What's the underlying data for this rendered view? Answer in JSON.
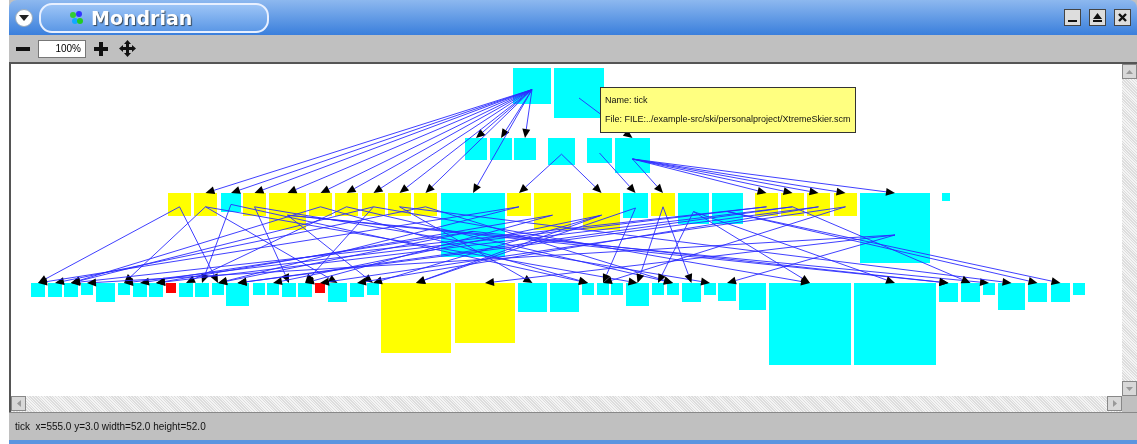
{
  "window": {
    "title": "Mondrian"
  },
  "toolbar": {
    "zoom": {
      "value": "100%"
    }
  },
  "graph": {
    "nodes": [
      {
        "color": "#00ffff"
      },
      {
        "color": "#00ffff"
      },
      {
        "color": "#00ffff"
      },
      {
        "color": "#00ffff"
      },
      {
        "color": "#00ffff"
      },
      {
        "color": "#00ffff"
      },
      {
        "color": "#00ffff"
      },
      {
        "color": "#00ffff"
      },
      {
        "color": "#ffff00"
      },
      {
        "color": "#ffff00"
      },
      {
        "color": "#00ffff"
      },
      {
        "color": "#ffff00"
      },
      {
        "color": "#ffff00"
      },
      {
        "color": "#ffff00"
      },
      {
        "color": "#ffff00"
      },
      {
        "color": "#ffff00"
      },
      {
        "color": "#ffff00"
      },
      {
        "color": "#ffff00"
      },
      {
        "color": "#00ffff"
      },
      {
        "color": "#ffff00"
      },
      {
        "color": "#ffff00"
      },
      {
        "color": "#ffff00"
      },
      {
        "color": "#00ffff"
      },
      {
        "color": "#ffff00"
      },
      {
        "color": "#00ffff"
      },
      {
        "color": "#00ffff"
      },
      {
        "color": "#ffff00"
      },
      {
        "color": "#ffff00"
      },
      {
        "color": "#ffff00"
      },
      {
        "color": "#ffff00"
      },
      {
        "color": "#00ffff"
      },
      {
        "color": "#00ffff"
      },
      {
        "color": "#00ffff"
      },
      {
        "color": "#00ffff"
      },
      {
        "color": "#00ffff"
      },
      {
        "color": "#00ffff"
      },
      {
        "color": "#00ffff"
      },
      {
        "color": "#00ffff"
      },
      {
        "color": "#00ffff"
      },
      {
        "color": "#00ffff"
      },
      {
        "color": "#ff0000"
      },
      {
        "color": "#00ffff"
      },
      {
        "color": "#00ffff"
      },
      {
        "color": "#00ffff"
      },
      {
        "color": "#00ffff"
      },
      {
        "color": "#00ffff"
      },
      {
        "color": "#00ffff"
      },
      {
        "color": "#00ffff"
      },
      {
        "color": "#00ffff"
      },
      {
        "color": "#ff0000"
      },
      {
        "color": "#00ffff"
      },
      {
        "color": "#00ffff"
      },
      {
        "color": "#00ffff"
      },
      {
        "color": "#ffff00"
      },
      {
        "color": "#ffff00"
      },
      {
        "color": "#00ffff"
      },
      {
        "color": "#00ffff"
      },
      {
        "color": "#00ffff"
      },
      {
        "color": "#00ffff"
      },
      {
        "color": "#00ffff"
      },
      {
        "color": "#00ffff"
      },
      {
        "color": "#00ffff"
      },
      {
        "color": "#00ffff"
      },
      {
        "color": "#00ffff"
      },
      {
        "color": "#00ffff"
      },
      {
        "color": "#00ffff"
      },
      {
        "color": "#00ffff"
      },
      {
        "color": "#00ffff"
      },
      {
        "color": "#00ffff"
      },
      {
        "color": "#00ffff"
      },
      {
        "color": "#00ffff"
      },
      {
        "color": "#00ffff"
      },
      {
        "color": "#00ffff"
      },
      {
        "color": "#00ffff"
      },
      {
        "color": "#00ffff"
      },
      {
        "color": "#00ffff"
      }
    ]
  },
  "tooltip": {
    "name": "Name: tick",
    "file": "File: FILE:../example-src/ski/personalproject/XtremeSkier.scm"
  },
  "status_bar": {
    "text": "tick  x=555.0 y=3.0 width=52.0 height=52.0"
  }
}
